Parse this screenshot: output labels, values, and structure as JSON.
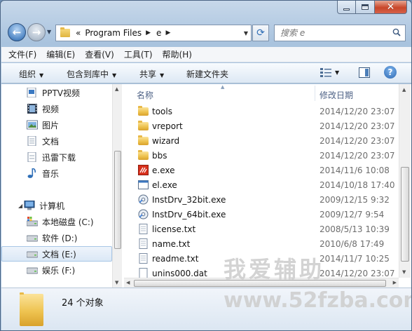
{
  "address": {
    "overflow_marker": "«",
    "segments": [
      "Program Files",
      "e"
    ]
  },
  "search": {
    "placeholder": "搜索 e"
  },
  "menu": [
    "文件(F)",
    "编辑(E)",
    "查看(V)",
    "工具(T)",
    "帮助(H)"
  ],
  "toolbar": {
    "organize": "组织",
    "include_in_library": "包含到库中",
    "share": "共享",
    "new_folder": "新建文件夹"
  },
  "nav": {
    "items": [
      {
        "label": "PPTV视频",
        "icon": "pptv-icon"
      },
      {
        "label": "视频",
        "icon": "video-library-icon"
      },
      {
        "label": "图片",
        "icon": "pictures-library-icon"
      },
      {
        "label": "文档",
        "icon": "documents-library-icon"
      },
      {
        "label": "迅雷下载",
        "icon": "download-library-icon"
      },
      {
        "label": "音乐",
        "icon": "music-library-icon"
      },
      {
        "label": "计算机",
        "icon": "computer-icon"
      },
      {
        "label": "本地磁盘 (C:)",
        "icon": "system-drive-icon"
      },
      {
        "label": "软件 (D:)",
        "icon": "drive-icon"
      },
      {
        "label": "文档 (E:)",
        "icon": "drive-icon"
      },
      {
        "label": "娱乐 (F:)",
        "icon": "drive-icon"
      }
    ]
  },
  "columns": {
    "name": "名称",
    "date_modified": "修改日期"
  },
  "files": [
    {
      "name": "tools",
      "date": "2014/12/20 23:07",
      "type": "folder"
    },
    {
      "name": "vreport",
      "date": "2014/12/20 23:07",
      "type": "folder"
    },
    {
      "name": "wizard",
      "date": "2014/12/20 23:07",
      "type": "folder"
    },
    {
      "name": "bbs",
      "date": "2014/12/20 23:07",
      "type": "shortcut"
    },
    {
      "name": "e.exe",
      "date": "2014/11/6 10:08",
      "type": "e-exe"
    },
    {
      "name": "el.exe",
      "date": "2014/10/18 17:40",
      "type": "exe"
    },
    {
      "name": "InstDrv_32bit.exe",
      "date": "2009/12/15 9:32",
      "type": "installer"
    },
    {
      "name": "InstDrv_64bit.exe",
      "date": "2009/12/7 9:54",
      "type": "installer"
    },
    {
      "name": "license.txt",
      "date": "2008/5/13 10:39",
      "type": "text"
    },
    {
      "name": "name.txt",
      "date": "2010/6/8 17:49",
      "type": "text"
    },
    {
      "name": "readme.txt",
      "date": "2014/11/7 10:25",
      "type": "text"
    },
    {
      "name": "unins000.dat",
      "date": "2014/12/20 23:07",
      "type": "file"
    }
  ],
  "status": {
    "count": "24 个对象"
  },
  "watermark": {
    "line1": "我爱辅助",
    "line2": "www.52fzba.com"
  },
  "colors": {
    "title_bar": "#a9c3de",
    "selection": "#dbe8f6",
    "folder": "#eec350"
  }
}
